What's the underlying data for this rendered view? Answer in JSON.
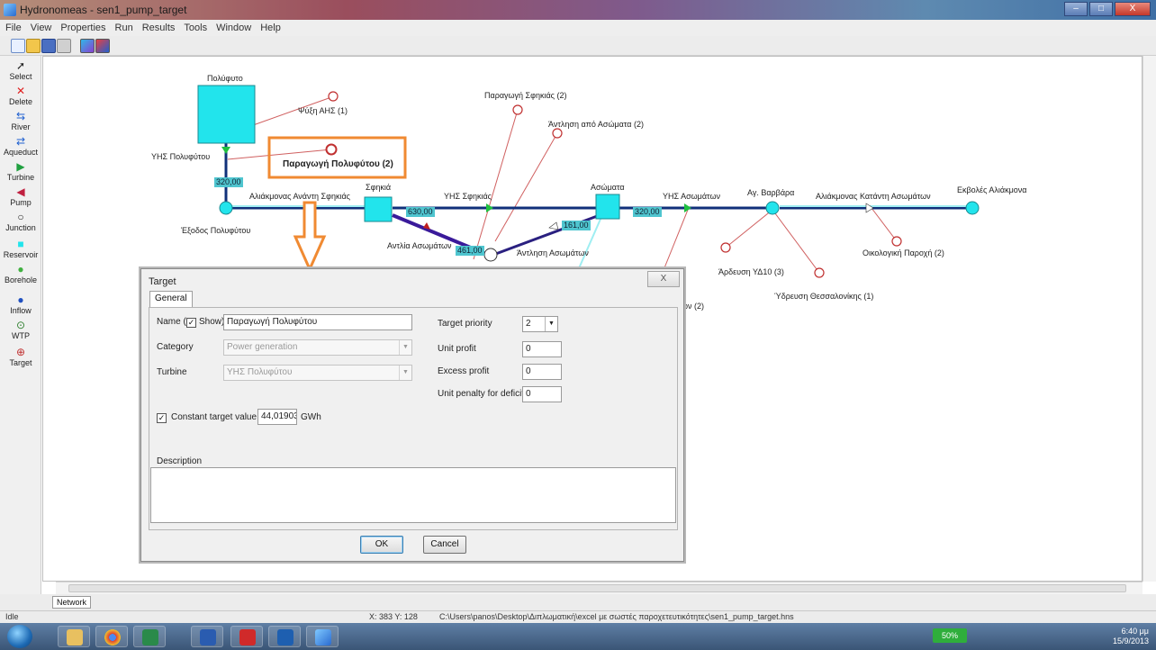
{
  "window": {
    "title": "Hydronomeas - sen1_pump_target",
    "buttons": [
      "–",
      "□",
      "X"
    ]
  },
  "menu": [
    "File",
    "View",
    "Properties",
    "Run",
    "Results",
    "Tools",
    "Window",
    "Help"
  ],
  "tools": [
    "Select",
    "Delete",
    "River",
    "Aqueduct",
    "Turbine",
    "Pump",
    "Junction",
    "Reservoir",
    "Borehole",
    "Inflow",
    "WTP",
    "Target"
  ],
  "network": {
    "labels": {
      "reservoir_poly": "Πολύφυτο",
      "turbine_poly": "ΥΗΣ Πολυφύτου",
      "outlet_poly": "Έξοδος Πολυφύτου",
      "cooling": "Ψύξη ΑΗΣ (1)",
      "target_selected": "Παραγωγή Πολυφύτου (2)",
      "sfikia_reservoir": "Σφηκιά",
      "aliakmonas_up": "Αλιάκμονας Ανάντη Σφηκιάς",
      "sfikia_target": "Παραγωγή Σφηκιάς (2)",
      "pump_target": "Άντληση από Ασώματα (2)",
      "sfikia_turbine": "ΥΗΣ Σφηκιάς",
      "asomata_reservoir": "Ασώματα",
      "pump": "Αντλία Ασωμάτων",
      "pumping": "Άντληση Ασωμάτων",
      "asomata_turbine": "ΥΗΣ Ασωμάτων",
      "ag_varvara": "Αγ. Βαρβάρα",
      "aliakmonas_down": "Αλιάκμονας Κατάντη Ασωμάτων",
      "mouths": "Εκβολές Αλιάκμονα",
      "ecological": "Οικολογική Παροχή (2)",
      "irrigation": "Άρδευση ΥΔ10 (3)",
      "water_supply": "Ύδρευση Θεσσαλονίκης (1)",
      "hidden_partial": "ων (2)"
    },
    "flows": [
      "320,00",
      "630,00",
      "461,00",
      "161,00",
      "320,00"
    ]
  },
  "dialog": {
    "title": "Target",
    "close": "X",
    "tab": "General",
    "name_label": "Name (",
    "show_label": "Show)",
    "name_value": "Παραγωγή Πολυφύτου",
    "category_label": "Category",
    "category_value": "Power generation",
    "turbine_label": "Turbine",
    "turbine_value": "ΥΗΣ Πολυφύτου",
    "priority_label": "Target priority",
    "priority_value": "2",
    "unit_profit_label": "Unit profit",
    "unit_profit_value": "0",
    "excess_profit_label": "Excess profit",
    "excess_profit_value": "0",
    "penalty_label": "Unit penalty for deficits",
    "penalty_value": "0",
    "constant_label": "Constant target value",
    "constant_value": "44,019032",
    "unit": "GWh",
    "description_label": "Description",
    "ok": "OK",
    "cancel": "Cancel"
  },
  "tabs": [
    "Network"
  ],
  "status": {
    "state": "Idle",
    "coords": "X: 383 Y: 128",
    "path": "C:\\Users\\panos\\Desktop\\Διπλωματική\\excel με σωστές παροχετευτικότητες\\sen1_pump_target.hns"
  },
  "taskbar": {
    "battery": "50%",
    "time": "6:40 μμ",
    "date": "15/9/2013"
  },
  "colors": {
    "reservoir": "#22e4ec",
    "river": "#10307a",
    "highlight": "#f08a32",
    "target": "#c03030"
  }
}
